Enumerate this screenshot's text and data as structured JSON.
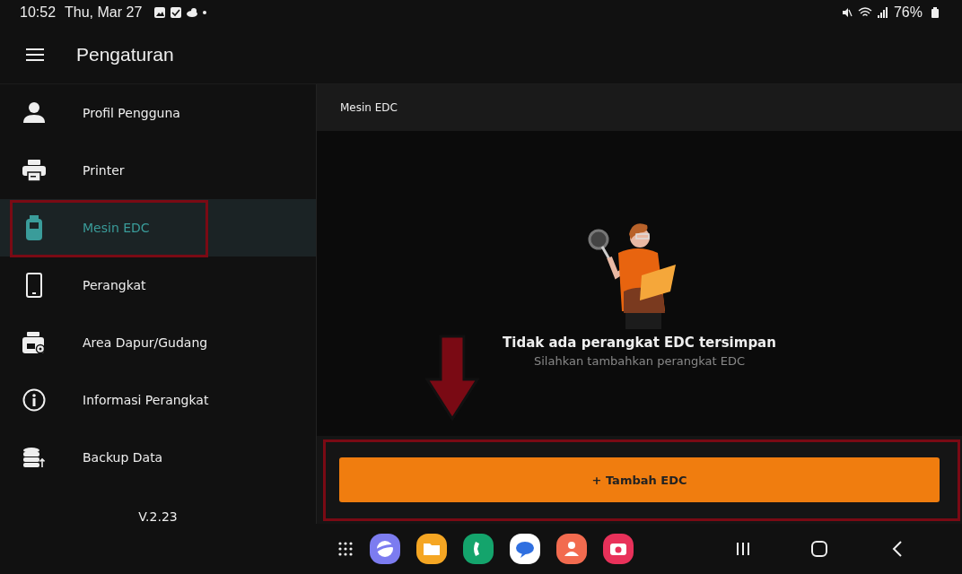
{
  "status_bar": {
    "time": "10:52",
    "date": "Thu, Mar 27",
    "battery": "76%"
  },
  "app_bar": {
    "title": "Pengaturan"
  },
  "sidebar": {
    "items": [
      {
        "label": "Profil Pengguna",
        "kind": "user",
        "selected": false
      },
      {
        "label": "Printer",
        "kind": "printer",
        "selected": false
      },
      {
        "label": "Mesin EDC",
        "kind": "edc",
        "selected": true
      },
      {
        "label": "Perangkat",
        "kind": "phone",
        "selected": false
      },
      {
        "label": "Area Dapur/Gudang",
        "kind": "kitchen",
        "selected": false
      },
      {
        "label": "Informasi Perangkat",
        "kind": "info",
        "selected": false
      },
      {
        "label": "Backup Data",
        "kind": "backup",
        "selected": false
      }
    ],
    "version": "V.2.23"
  },
  "content": {
    "header": "Mesin EDC",
    "empty_title": "Tidak ada perangkat EDC tersimpan",
    "empty_subtitle": "Silahkan tambahkan perangkat EDC",
    "add_button": "+ Tambah EDC"
  }
}
